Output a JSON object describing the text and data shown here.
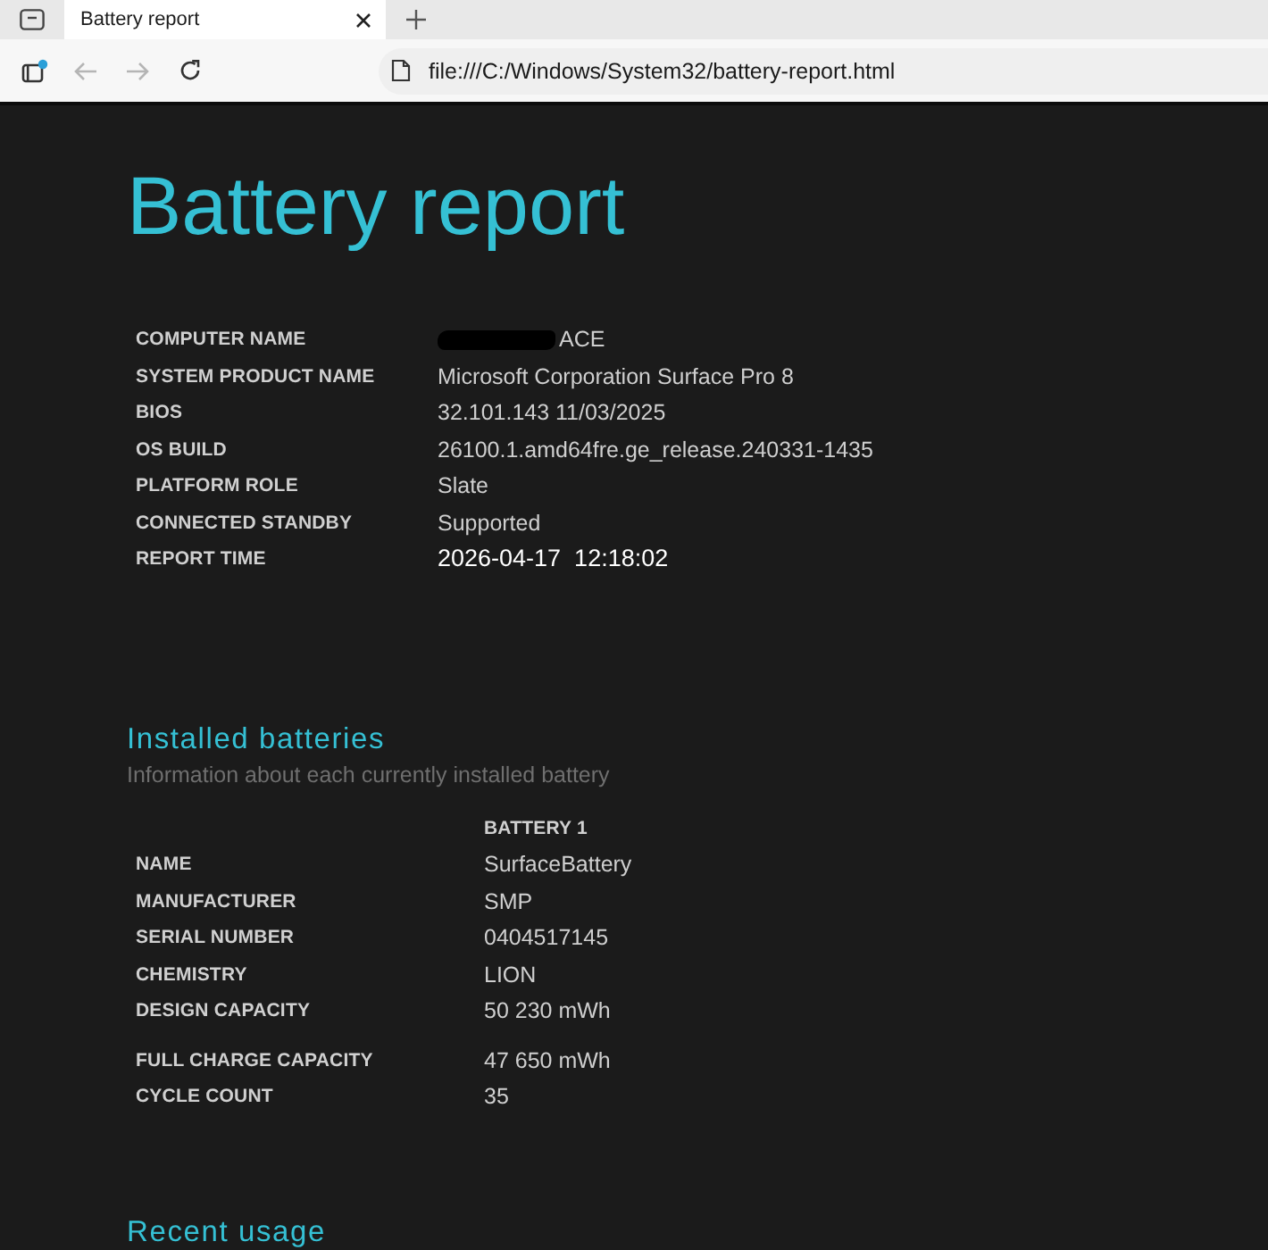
{
  "browser": {
    "tabs": [
      {
        "title": "Battery report",
        "selected": true
      }
    ],
    "toolbar": [
      {
        "kind": "panel",
        "disabled": false
      },
      {
        "kind": "back",
        "disabled": true
      },
      {
        "kind": "forward",
        "disabled": true
      },
      {
        "kind": "reload",
        "disabled": false
      }
    ],
    "address_bar": {
      "url": "file:///C:/Windows/System32/battery-report.html"
    }
  },
  "report": {
    "title": "Battery report",
    "system_info": [
      {
        "label": "COMPUTER NAME",
        "value": "ACE",
        "redacted": true
      },
      {
        "label": "SYSTEM PRODUCT NAME",
        "value": "Microsoft Corporation Surface Pro 8",
        "redacted": false
      },
      {
        "label": "BIOS",
        "value": "32.101.143 11/03/2025",
        "redacted": false
      },
      {
        "label": "OS BUILD",
        "value": "26100.1.amd64fre.ge_release.240331-1435",
        "redacted": false
      },
      {
        "label": "PLATFORM ROLE",
        "value": "Slate",
        "redacted": false
      },
      {
        "label": "CONNECTED STANDBY",
        "value": "Supported",
        "redacted": false
      },
      {
        "label": "REPORT TIME",
        "value": "2026-04-17  12:18:02",
        "redacted": false,
        "emphasized": true
      }
    ]
  },
  "installed_batteries": {
    "heading": "Installed batteries",
    "subtitle": "Information about each currently installed battery",
    "column": "BATTERY 1",
    "row_groups": [
      [
        {
          "label": "NAME",
          "value": "SurfaceBattery"
        },
        {
          "label": "MANUFACTURER",
          "value": "SMP"
        },
        {
          "label": "SERIAL NUMBER",
          "value": "0404517145"
        },
        {
          "label": "CHEMISTRY",
          "value": "LION"
        },
        {
          "label": "DESIGN CAPACITY",
          "value": "50 230 mWh"
        }
      ],
      [
        {
          "label": "FULL CHARGE CAPACITY",
          "value": "47 650 mWh"
        },
        {
          "label": "CYCLE COUNT",
          "value": "35"
        }
      ]
    ]
  },
  "recent_usage": {
    "heading": "Recent usage"
  }
}
